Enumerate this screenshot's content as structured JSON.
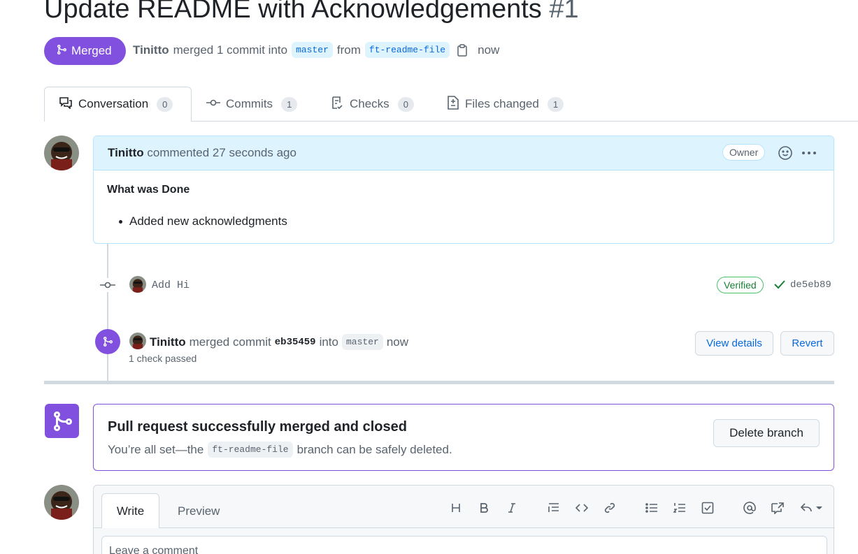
{
  "pr": {
    "title": "Update README with Acknowledgements",
    "number": "#1",
    "state_label": "Merged",
    "author": "Tinitto",
    "merged_text": "merged 1 commit into",
    "base_branch": "master",
    "from_text": "from",
    "head_branch": "ft-readme-file",
    "time": "now"
  },
  "tabs": [
    {
      "label": "Conversation",
      "count": "0"
    },
    {
      "label": "Commits",
      "count": "1"
    },
    {
      "label": "Checks",
      "count": "0"
    },
    {
      "label": "Files changed",
      "count": "1"
    }
  ],
  "comment": {
    "author": "Tinitto",
    "action": "commented 27 seconds ago",
    "badge": "Owner",
    "heading": "What was Done",
    "items": [
      "Added new acknowledgments"
    ]
  },
  "timeline": {
    "commit_message": "Add Hi",
    "verified_label": "Verified",
    "commit_sha": "de5eb89",
    "merge_author": "Tinitto",
    "merge_text": "merged commit",
    "merge_sha": "eb35459",
    "into_text": "into",
    "merge_branch": "master",
    "merge_time": "now",
    "checks": "1 check passed",
    "view_details": "View details",
    "revert": "Revert"
  },
  "merged_box": {
    "title": "Pull request successfully merged and closed",
    "sub_prefix": "You’re all set—the",
    "branch": "ft-readme-file",
    "sub_suffix": "branch can be safely deleted.",
    "delete_button": "Delete branch"
  },
  "editor": {
    "write_tab": "Write",
    "preview_tab": "Preview",
    "placeholder": "Leave a comment",
    "toolbar": [
      "heading-icon",
      "bold-icon",
      "italic-icon",
      "quote-icon",
      "code-icon",
      "link-icon",
      "unordered-list-icon",
      "ordered-list-icon",
      "task-list-icon",
      "mention-icon",
      "cross-reference-icon",
      "saved-replies-icon"
    ]
  },
  "colors": {
    "merged_purple": "#8250df",
    "link_blue": "#0969da",
    "verified_green": "#1a7f37",
    "comment_header_bg": "#ddf4ff"
  }
}
